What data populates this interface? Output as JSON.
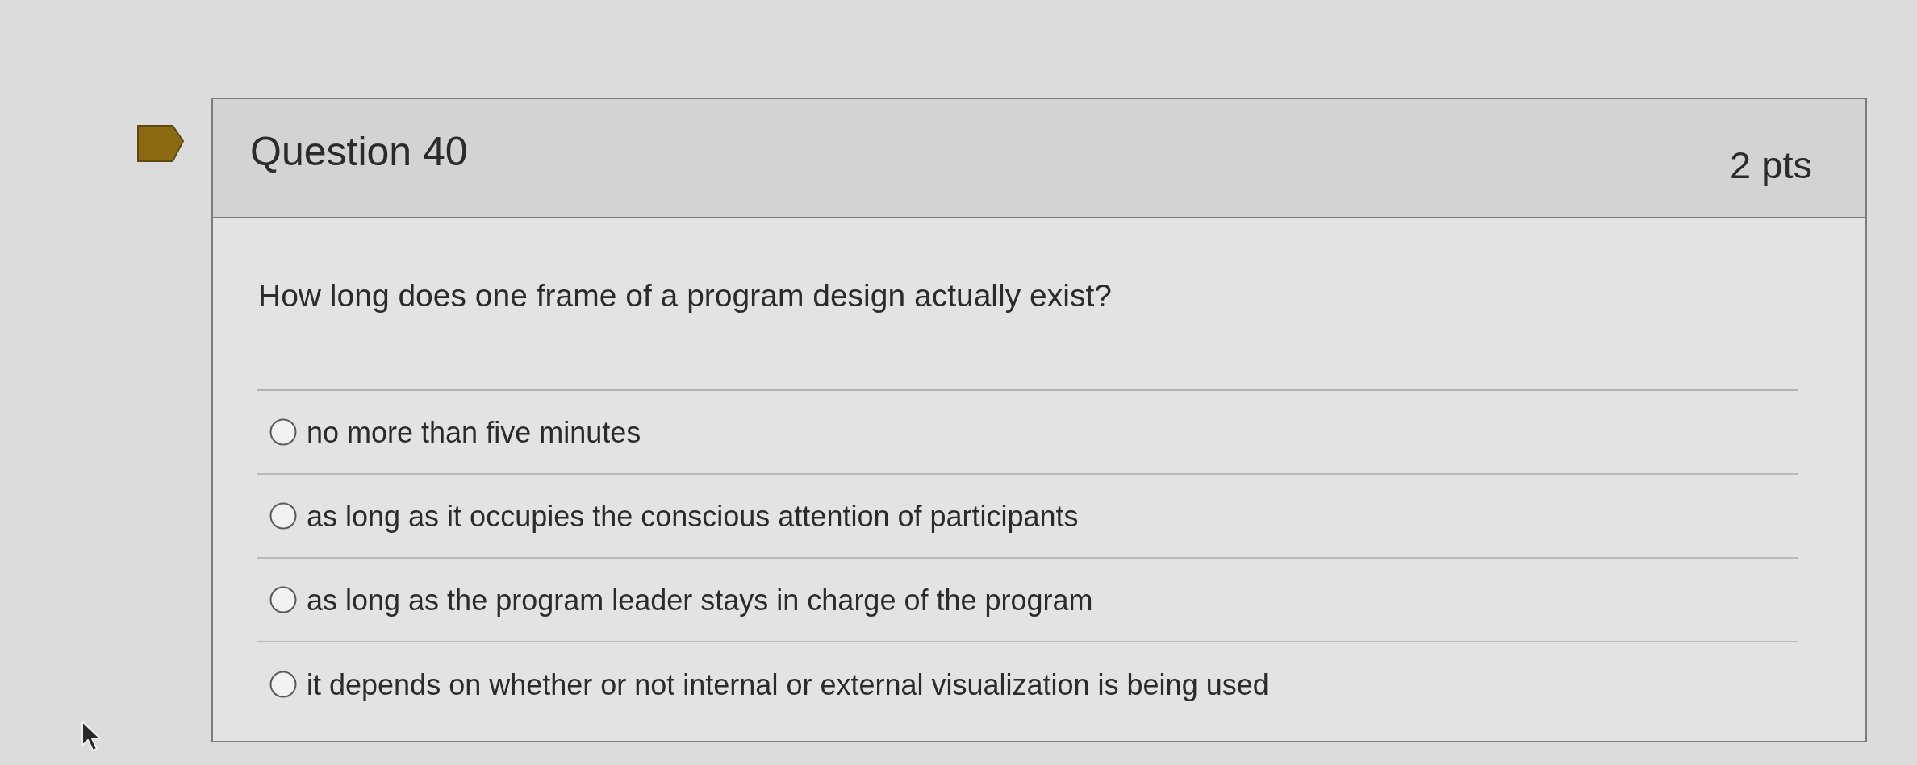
{
  "question": {
    "flagged": true,
    "title": "Question 40",
    "points": "2 pts",
    "text": "How long does one frame of a program design actually exist?",
    "answers": [
      {
        "label": "no more than five minutes",
        "selected": false
      },
      {
        "label": "as long as it occupies the conscious attention of participants",
        "selected": false
      },
      {
        "label": "as long as the program leader stays in charge of the program",
        "selected": false
      },
      {
        "label": "it depends on whether or not internal or external visualization is being used",
        "selected": false
      }
    ]
  }
}
